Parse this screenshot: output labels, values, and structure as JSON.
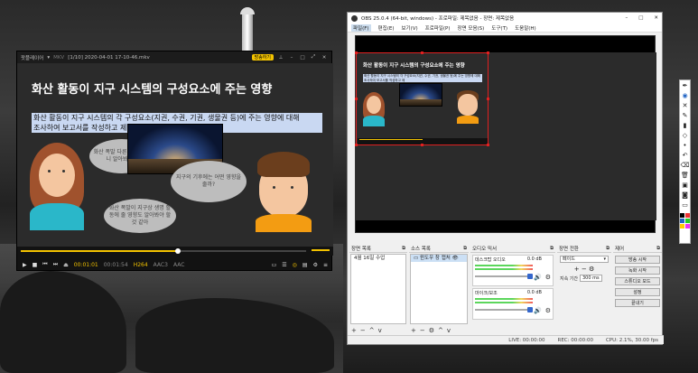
{
  "player": {
    "title_left": "팟플레이어",
    "format": "MKV",
    "file": "[1/10] 2020-04-01 17-10-46.mkv",
    "badge": "방송하기",
    "slide_title": "화산 활동이 지구 시스템의 구성요소에 주는 영향",
    "slide_text_line1": "화산 활동이 지구 시스템의 각 구성요소(지권, 수권, 기권, 생물권 등)에 주는 영향에 대해",
    "slide_text_line2": "조사하여 보고서를 작성하고 제",
    "bubble1": "화산 폭발 다른 영향을 보니 알아봐야겠",
    "bubble2": "지구의 기후에는 어떤 영향을 줄까?",
    "bubble3": "화산 폭발이 지구상 생명 활동에 줄 영향도 알아봐야 할 것 같아",
    "time_current": "00:01:01",
    "time_total": "00:01:54",
    "codec1": "H264",
    "codec2": "AAC3",
    "codec3": "AAC",
    "progress": 0.55
  },
  "obs": {
    "title": "OBS 25.0.4 (64-bit, windows) - 프로파일: 제목없음 - 장면: 제목없음",
    "menu": [
      "파일(F)",
      "편집(E)",
      "보기(V)",
      "프로파일(P)",
      "장면 모음(S)",
      "도구(T)",
      "도움말(H)"
    ],
    "mini_title": "화산 활동이 지구 시스템의 구성요소에 주는 영향",
    "mini_text": "화산 활동이 지구 시스템의 각 구성요소(지권, 수권, 기권, 생물권 등)에 주는 영향에 대해 조사하여 보고서를 작성하고 제",
    "panels": {
      "scenes_header": "장면 목록",
      "scene_item": "4월 16일 수업",
      "sources_header": "소스 목록",
      "source_item": "윈도우 창 캡처",
      "mixer_header": "오디오 믹서",
      "ch1_name": "데스크탑 오디오",
      "ch1_db": "0.0 dB",
      "ch2_name": "마이크/보조",
      "ch2_db": "0.0 dB",
      "trans_header": "장면 전환",
      "trans_type": "페이드",
      "trans_dur_label": "지속 기간",
      "trans_dur": "300 ms",
      "ctrl_header": "제어",
      "buttons": [
        "방송 시작",
        "녹화 시작",
        "스튜디오 모드",
        "설정",
        "끝내기"
      ]
    },
    "status": {
      "live": "LIVE: 00:00:00",
      "rec": "REC: 00:00:00",
      "cpu": "CPU: 2.1%, 30.00 fps"
    }
  },
  "colors": {
    "accent_yellow": "#f2c200",
    "selection_red": "#e02020",
    "obs_blue": "#2466c4"
  }
}
